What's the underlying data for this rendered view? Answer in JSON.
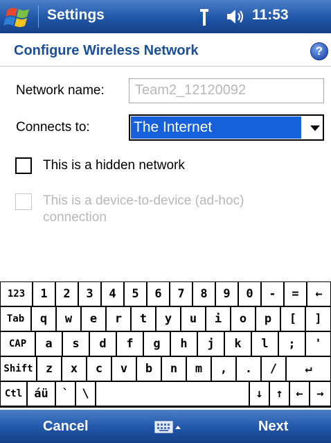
{
  "titlebar": {
    "title": "Settings",
    "time": "11:53",
    "icons": [
      "windows-start-icon",
      "antenna-icon",
      "volume-icon"
    ]
  },
  "heading": {
    "title": "Configure Wireless Network",
    "help_icon": "?"
  },
  "form": {
    "network_name_label": "Network name:",
    "network_name_value": "Team2_12120092",
    "connects_to_label": "Connects to:",
    "connects_to_value": "The Internet",
    "hidden_network_label": "This is a hidden network",
    "hidden_network_checked": false,
    "adhoc_label_line1": "This is a device-to-device (ad-hoc)",
    "adhoc_label_line2": "connection",
    "adhoc_checked": false,
    "adhoc_enabled": false
  },
  "keyboard": {
    "rows": [
      [
        "123",
        "1",
        "2",
        "3",
        "4",
        "5",
        "6",
        "7",
        "8",
        "9",
        "0",
        "-",
        "=",
        "←"
      ],
      [
        "Tab",
        "q",
        "w",
        "e",
        "r",
        "t",
        "y",
        "u",
        "i",
        "o",
        "p",
        "[",
        "]"
      ],
      [
        "CAP",
        "a",
        "s",
        "d",
        "f",
        "g",
        "h",
        "j",
        "k",
        "l",
        ";",
        "'"
      ],
      [
        "Shift",
        "z",
        "x",
        "c",
        "v",
        "b",
        "n",
        "m",
        ",",
        ".",
        "/",
        "↵"
      ],
      [
        "Ctl",
        "áü",
        "`",
        "\\",
        " ",
        "↓",
        "↑",
        "←",
        "→"
      ]
    ]
  },
  "softkeys": {
    "left": "Cancel",
    "right": "Next",
    "center_icon": "keyboard-icon"
  },
  "colors": {
    "bar": "#1f56a8",
    "heading": "#1a4f99",
    "selection": "#1660d9"
  }
}
